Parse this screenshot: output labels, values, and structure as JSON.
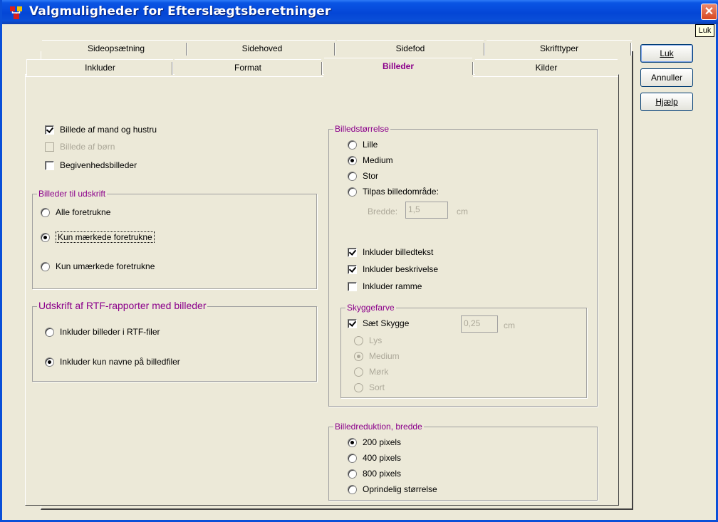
{
  "window": {
    "title": "Valgmuligheder for Efterslægtsberetninger",
    "close_glyph": "✕",
    "tooltip": "Luk"
  },
  "tabs_back_row": [
    "Sideopsætning",
    "Sidehoved",
    "Sidefod",
    "Skrifttyper"
  ],
  "tabs_front_row": [
    "Inkluder",
    "Format",
    "Billeder",
    "Kilder"
  ],
  "active_tab": "Billeder",
  "buttons": {
    "close": "Luk",
    "cancel": "Annuller",
    "help": "Hjælp"
  },
  "left": {
    "checks": [
      {
        "label": "Billede af mand og hustru",
        "checked": true,
        "disabled": false
      },
      {
        "label": "Billede af børn",
        "checked": false,
        "disabled": true
      },
      {
        "label": "Begivenhedsbilleder",
        "checked": false,
        "disabled": false
      }
    ],
    "print_group": {
      "title": "Billeder til udskrift",
      "options": [
        {
          "label": "Alle foretrukne",
          "checked": false
        },
        {
          "label": "Kun mærkede foretrukne",
          "checked": true
        },
        {
          "label": "Kun umærkede foretrukne",
          "checked": false
        }
      ]
    },
    "rtf_group": {
      "title": "Udskrift af RTF-rapporter med billeder",
      "options": [
        {
          "label": "Inkluder billeder i RTF-filer",
          "checked": false
        },
        {
          "label": "Inkluder kun navne på billedfiler",
          "checked": true
        }
      ]
    }
  },
  "right": {
    "size_group": {
      "title": "Billedstørrelse",
      "options": [
        {
          "label": "Lille",
          "checked": false
        },
        {
          "label": "Medium",
          "checked": true
        },
        {
          "label": "Stor",
          "checked": false
        },
        {
          "label": "Tilpas billedområde:",
          "checked": false
        }
      ],
      "width_label": "Bredde:",
      "width_value": "1,5",
      "width_unit": "cm",
      "checks": [
        {
          "label": "Inkluder billedtekst",
          "checked": true
        },
        {
          "label": "Inkluder beskrivelse",
          "checked": true
        },
        {
          "label": "Inkluder ramme",
          "checked": false
        }
      ]
    },
    "shadow_group": {
      "title": "Skyggefarve",
      "set_shadow": {
        "label": "Sæt Skygge",
        "checked": true
      },
      "shadow_value": "0,25",
      "shadow_unit": "cm",
      "options": [
        {
          "label": "Lys",
          "checked": false
        },
        {
          "label": "Medium",
          "checked": true
        },
        {
          "label": "Mørk",
          "checked": false
        },
        {
          "label": "Sort",
          "checked": false
        }
      ]
    },
    "reduction_group": {
      "title": "Billedreduktion, bredde",
      "options": [
        {
          "label": "200 pixels",
          "checked": true
        },
        {
          "label": "400 pixels",
          "checked": false
        },
        {
          "label": "800 pixels",
          "checked": false
        },
        {
          "label": "Oprindelig størrelse",
          "checked": false
        }
      ]
    }
  },
  "colors": {
    "group_title": "#8B008B",
    "titlebar": "#0A4FD8",
    "face": "#ECE9D8"
  }
}
